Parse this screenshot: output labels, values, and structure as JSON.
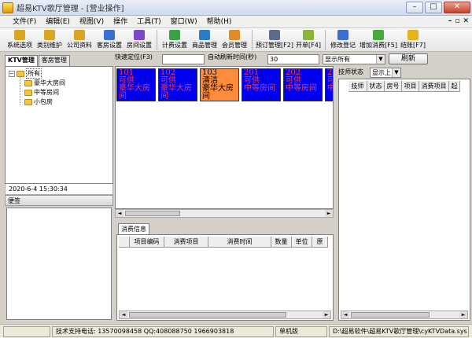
{
  "window": {
    "title": "超易KTV歌厅管理 - [营业操作]"
  },
  "menu": [
    "文件(F)",
    "编辑(E)",
    "视图(V)",
    "操作",
    "工具(T)",
    "窗口(W)",
    "帮助(H)"
  ],
  "toolbar": [
    {
      "label": "系统选项",
      "color": "#d9a522"
    },
    {
      "label": "类别维护",
      "color": "#d9a522"
    },
    {
      "label": "公司资料",
      "color": "#d9a522"
    },
    {
      "label": "客房设置",
      "color": "#3c6fd1"
    },
    {
      "label": "房间设置",
      "color": "#7a4bc4"
    },
    {
      "label": "计费设置",
      "color": "#3aa244"
    },
    {
      "label": "商品管理",
      "color": "#2b7bc9"
    },
    {
      "label": "会员管理",
      "color": "#e08a2a"
    },
    {
      "label": "预订管理[F2]",
      "color": "#5a6b8c"
    },
    {
      "label": "开单[F4]",
      "color": "#8bb53a"
    },
    {
      "label": "修改登记",
      "color": "#3c6fd1"
    },
    {
      "label": "增加消费[F5]",
      "color": "#4aa83e"
    },
    {
      "label": "结账[F7]",
      "color": "#e6b21e"
    }
  ],
  "tabs": [
    "KTV管理",
    "客房管理"
  ],
  "tree": {
    "root": "所有",
    "children": [
      "豪华大房间",
      "中等房间",
      "小包房"
    ]
  },
  "datetime": "2020-6-4 15:30:34",
  "memo_label": "便签",
  "filter": {
    "quick_locate_label": "快速定位(F3)",
    "quick_locate_value": "",
    "auto_refresh_label": "自动刷新时间(秒)",
    "auto_refresh_value": "30",
    "display_select": "显示所有",
    "refresh_button": "刷新"
  },
  "rooms": [
    {
      "number": "101",
      "status": "可供",
      "type": "豪华大房",
      "type2": "间",
      "state": "used"
    },
    {
      "number": "102",
      "status": "可供",
      "type": "豪华大房",
      "type2": "间",
      "state": "used"
    },
    {
      "number": "103",
      "status": "清洁",
      "type": "豪华大房",
      "type2": "间",
      "state": "clean"
    },
    {
      "number": "201",
      "status": "可供",
      "type": "中等房间",
      "type2": "",
      "state": "used"
    },
    {
      "number": "202",
      "status": "可供",
      "type": "中等房间",
      "type2": "",
      "state": "used"
    },
    {
      "number": "2",
      "status": "可",
      "type": "中",
      "type2": "",
      "state": "used"
    }
  ],
  "consumption": {
    "tab_label": "消费信息",
    "columns": [
      "项目编码",
      "消费项目",
      "消费时间",
      "数量",
      "单位",
      "原"
    ]
  },
  "technician": {
    "status_label": "技师状态",
    "status_select": "显示上",
    "columns": [
      "技师",
      "状态",
      "房号",
      "项目",
      "消费项目",
      "起"
    ]
  },
  "status": {
    "support": "技术支持电话: 13570098458 QQ:408088750 1966903818",
    "mode": "单机版",
    "path": "D:\\超易软件\\超易KTV歌厅管理\\cyKTVData.sys"
  }
}
